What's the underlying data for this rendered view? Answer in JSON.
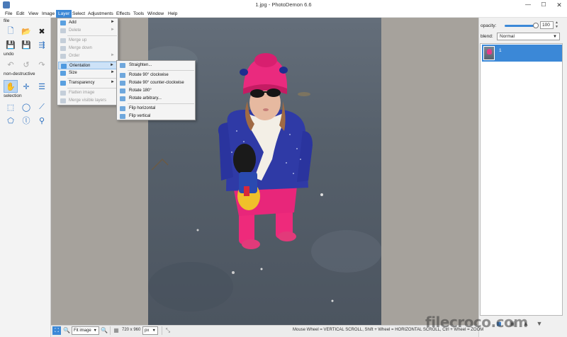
{
  "window": {
    "title": "1.jpg  -  PhotoDemon 6.6",
    "min": "—",
    "max": "☐",
    "close": "✕"
  },
  "menubar": [
    "File",
    "Edit",
    "View",
    "Image",
    "Layer",
    "Select",
    "Adjustments",
    "Effects",
    "Tools",
    "Window",
    "Help"
  ],
  "active_menu": "Layer",
  "layer_menu": [
    {
      "label": "Add",
      "enabled": true,
      "submenu": true
    },
    {
      "label": "Delete",
      "enabled": false,
      "submenu": true
    },
    {
      "label": "Merge up",
      "enabled": false
    },
    {
      "label": "Merge down",
      "enabled": false
    },
    {
      "label": "Order",
      "enabled": false,
      "submenu": true
    },
    {
      "label": "Orientation",
      "enabled": true,
      "submenu": true,
      "highlighted": true
    },
    {
      "label": "Size",
      "enabled": true,
      "submenu": true
    },
    {
      "label": "Transparency",
      "enabled": true,
      "submenu": true
    },
    {
      "label": "Flatten image",
      "enabled": false
    },
    {
      "label": "Merge visible layers",
      "enabled": false
    }
  ],
  "orientation_submenu": [
    "Straighten...",
    "Rotate 90° clockwise",
    "Rotate 90° counter-clockwise",
    "Rotate 180°",
    "Rotate arbitrary...",
    "Flip horizontal",
    "Flip vertical"
  ],
  "toolbox": {
    "sections": {
      "file": "file",
      "undo": "undo",
      "non_destructive": "non-destructive",
      "selection": "selection"
    },
    "file_tools": [
      {
        "icon": "new-file-icon",
        "glyph": "🗋"
      },
      {
        "icon": "open-folder-icon",
        "glyph": "📂"
      },
      {
        "icon": "close-x-icon",
        "glyph": "✖"
      },
      {
        "icon": "save-icon",
        "glyph": "💾"
      },
      {
        "icon": "save-as-icon",
        "glyph": "💾"
      },
      {
        "icon": "export-icon",
        "glyph": "⇶"
      }
    ],
    "undo_tools": [
      {
        "icon": "undo-icon",
        "glyph": "↶"
      },
      {
        "icon": "history-icon",
        "glyph": "↺"
      },
      {
        "icon": "redo-icon",
        "glyph": "↷"
      }
    ],
    "nd_tools": [
      {
        "icon": "hand-icon",
        "glyph": "✋"
      },
      {
        "icon": "move-icon",
        "glyph": "✛"
      },
      {
        "icon": "quick-fix-icon",
        "glyph": "☰"
      }
    ],
    "selection_tools": [
      {
        "icon": "rect-select-icon",
        "glyph": "⬚"
      },
      {
        "icon": "ellipse-select-icon",
        "glyph": "◯"
      },
      {
        "icon": "line-select-icon",
        "glyph": "⟋"
      },
      {
        "icon": "polygon-select-icon",
        "glyph": "⬠"
      },
      {
        "icon": "lasso-select-icon",
        "glyph": "ⓛ"
      },
      {
        "icon": "wand-select-icon",
        "glyph": "⚲"
      }
    ]
  },
  "right_panel": {
    "opacity_label": "opacity:",
    "opacity_value": "100",
    "opacity_fraction": 1.0,
    "blend_label": "blend:",
    "blend_value": "Normal",
    "layers": [
      {
        "name": "1",
        "selected": true
      }
    ]
  },
  "status": {
    "fit_value": "Fit image",
    "image_size": "720 x 960",
    "unit": "px",
    "hint": "Mouse Wheel = VERTICAL SCROLL, Shift + Wheel = HORIZONTAL SCROLL, Ctrl + Wheel = ZOOM"
  },
  "watermark": "filecroco.com",
  "colors": {
    "accent": "#3b88d7",
    "canvas_bg": "#a6a29c",
    "menu_highlight": "#cde2f7"
  }
}
